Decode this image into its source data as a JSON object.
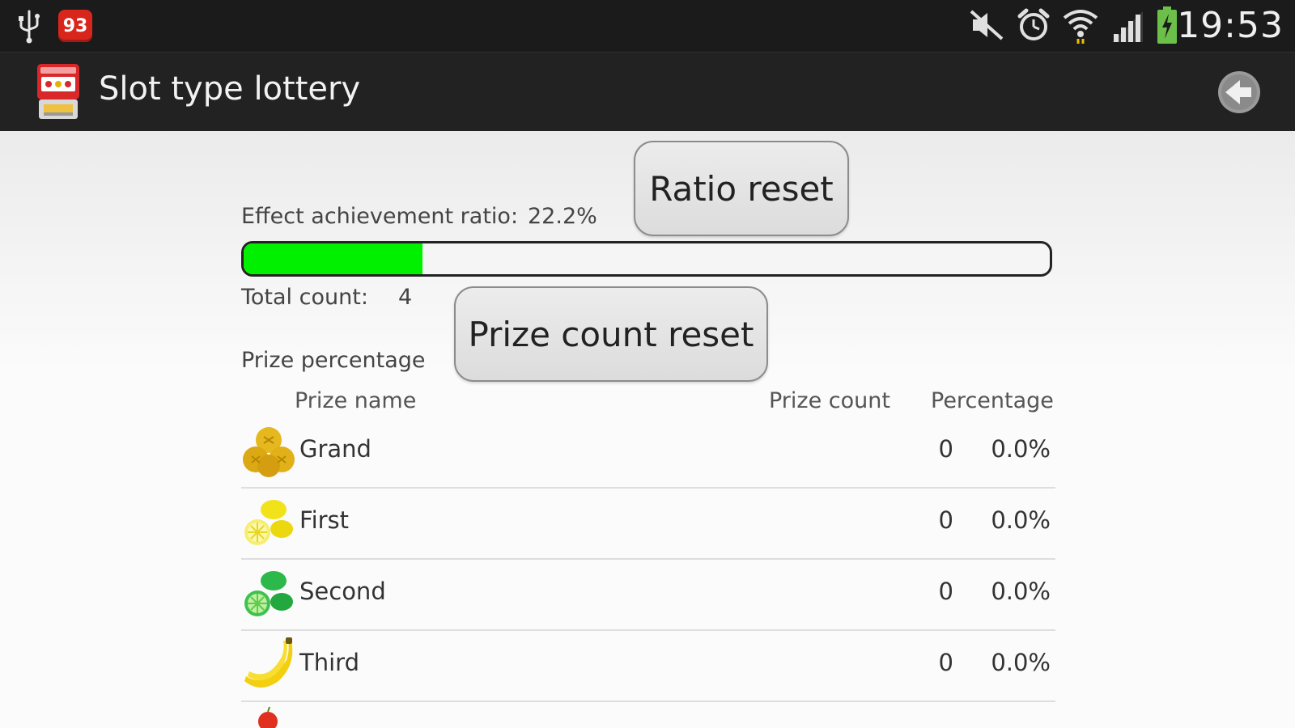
{
  "status_bar": {
    "notification_count": "93",
    "time": "19:53"
  },
  "action_bar": {
    "title": "Slot type lottery"
  },
  "buttons": {
    "ratio_reset": "Ratio reset",
    "prize_count_reset": "Prize count reset"
  },
  "effect": {
    "label": "Effect achievement ratio:",
    "value": "22.2%",
    "progress_fraction": 0.222,
    "bar_color": "#00f000"
  },
  "total": {
    "label": "Total count:",
    "value": "4"
  },
  "prize_section": {
    "title": "Prize percentage"
  },
  "table": {
    "headers": {
      "name": "Prize name",
      "count": "Prize count",
      "percentage": "Percentage"
    },
    "rows": [
      {
        "icon": "orange-fruit-icon",
        "name": "Grand",
        "count": "0",
        "percentage": "0.0%"
      },
      {
        "icon": "lemon-fruit-icon",
        "name": "First",
        "count": "0",
        "percentage": "0.0%"
      },
      {
        "icon": "lime-fruit-icon",
        "name": "Second",
        "count": "0",
        "percentage": "0.0%"
      },
      {
        "icon": "banana-fruit-icon",
        "name": "Third",
        "count": "0",
        "percentage": "0.0%"
      }
    ]
  }
}
